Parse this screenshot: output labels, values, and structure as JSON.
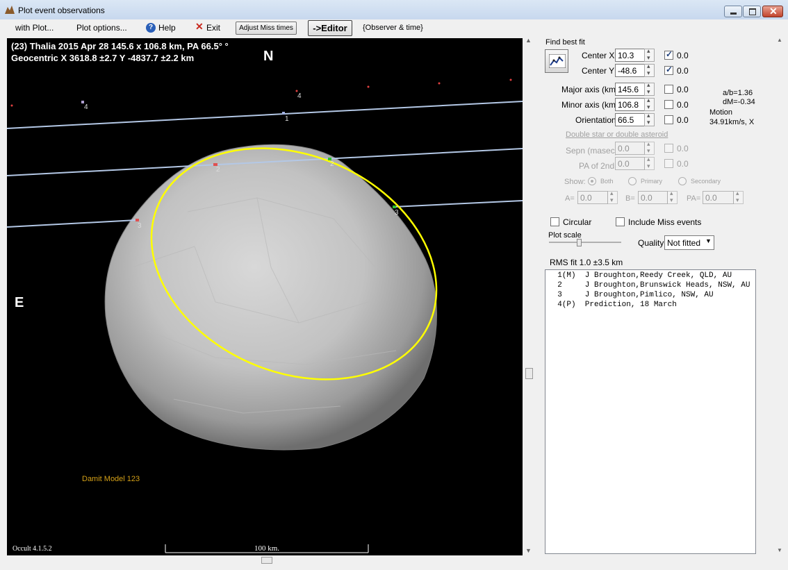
{
  "window": {
    "title": "Plot event observations"
  },
  "menu": {
    "with_plot": "with Plot...",
    "plot_options": "Plot options...",
    "help": "Help",
    "exit": "Exit",
    "adjust_miss": "Adjust Miss times",
    "editor": "->Editor",
    "observer_time": "{Observer & time}"
  },
  "plot": {
    "header_line1": "(23) Thalia  2015 Apr 28   145.6 x 106.8 km, PA 66.5° °",
    "header_line2": "Geocentric  X  3618.8 ±2.7  Y -4837.7 ±2.2 km",
    "north": "N",
    "east": "E",
    "model_label": "Damit Model 123",
    "version": "Occult 4.1.5.2",
    "scale_label": "100 km.",
    "chord_labels": [
      "4",
      "4",
      "1",
      "2",
      "2",
      "3",
      "3"
    ],
    "colors": {
      "background": "#000000",
      "ellipse": "#ffff00",
      "chord": "#b4c8e6",
      "model_label": "#d4a017"
    }
  },
  "fit": {
    "title": "Find best fit",
    "center_x_label": "Center X",
    "center_x": "10.3",
    "center_x_delta": "0.0",
    "center_y_label": "Center Y",
    "center_y": "-48.6",
    "center_y_delta": "0.0",
    "major_label": "Major axis (km)",
    "major": "145.6",
    "major_delta": "0.0",
    "minor_label": "Minor axis (km)",
    "minor": "106.8",
    "minor_delta": "0.0",
    "orient_label": "Orientation",
    "orient": "66.5",
    "orient_delta": "0.0",
    "ab_ratio": "a/b=1.36",
    "dm": "dM=-0.34",
    "motion_label": "Motion",
    "motion_value": "34.91km/s, X"
  },
  "double": {
    "title": "Double star  or  double asteroid",
    "sepn_label": "Sepn (masec)",
    "sepn": "0.0",
    "sepn_delta": "0.0",
    "pa2_label": "PA of 2nd",
    "pa2": "0.0",
    "pa2_delta": "0.0",
    "show_label": "Show:",
    "both": "Both",
    "primary": "Primary",
    "secondary": "Secondary",
    "a_label": "A=",
    "a_val": "0.0",
    "b_label": "B=",
    "b_val": "0.0",
    "pa_label": "PA=",
    "pa_val": "0.0"
  },
  "options": {
    "circular": "Circular",
    "include_miss": "Include Miss events",
    "plot_scale": "Plot scale",
    "quality_label": "Quality",
    "quality_value": "Not fitted"
  },
  "results": {
    "rms": "RMS fit  1.0 ±3.5 km",
    "rows": [
      "  1(M)  J Broughton,Reedy Creek, QLD, AU",
      "  2     J Broughton,Brunswick Heads, NSW, AU",
      "  3     J Broughton,Pimlico, NSW, AU",
      "  4(P)  Prediction, 18 March"
    ]
  }
}
